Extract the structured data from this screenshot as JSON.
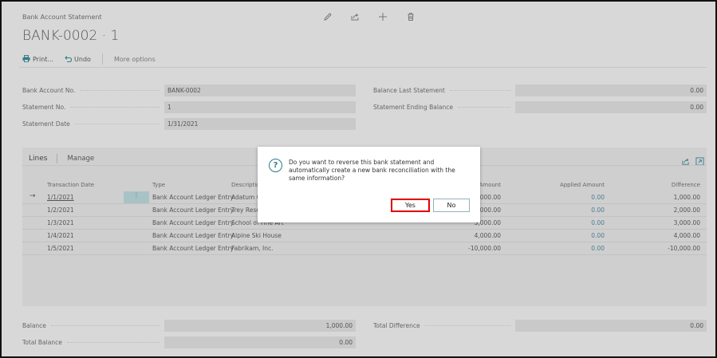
{
  "header": {
    "label": "Bank Account Statement",
    "title": "BANK-0002 · 1",
    "icons": [
      "edit-icon",
      "share-icon",
      "add-icon",
      "delete-icon"
    ]
  },
  "actions": {
    "print": "Print...",
    "undo": "Undo",
    "more": "More options"
  },
  "fields": {
    "bank_account_no": {
      "label": "Bank Account No.",
      "value": "BANK-0002"
    },
    "statement_no": {
      "label": "Statement No.",
      "value": "1"
    },
    "statement_date": {
      "label": "Statement Date",
      "value": "1/31/2021"
    },
    "balance_last_statement": {
      "label": "Balance Last Statement",
      "value": "0.00"
    },
    "statement_ending_balance": {
      "label": "Statement Ending Balance",
      "value": "0.00"
    }
  },
  "lines": {
    "tab_lines": "Lines",
    "tab_manage": "Manage",
    "columns": {
      "transaction_date": "Transaction Date",
      "type": "Type",
      "description": "Description",
      "amount": "Amount",
      "applied_amount": "Applied Amount",
      "difference": "Difference"
    },
    "rows": [
      {
        "date": "1/1/2021",
        "type": "Bank Account Ledger Entry",
        "description": "Adatum C",
        "amount": "1,000.00",
        "applied": "0.00",
        "difference": "1,000.00"
      },
      {
        "date": "1/2/2021",
        "type": "Bank Account Ledger Entry",
        "description": "Trey Rese",
        "amount": "2,000.00",
        "applied": "0.00",
        "difference": "2,000.00"
      },
      {
        "date": "1/3/2021",
        "type": "Bank Account Ledger Entry",
        "description": "School of Fine Art",
        "amount": "3,000.00",
        "applied": "0.00",
        "difference": "3,000.00"
      },
      {
        "date": "1/4/2021",
        "type": "Bank Account Ledger Entry",
        "description": "Alpine Ski House",
        "amount": "4,000.00",
        "applied": "0.00",
        "difference": "4,000.00"
      },
      {
        "date": "1/5/2021",
        "type": "Bank Account Ledger Entry",
        "description": "Fabrikam, Inc.",
        "amount": "-10,000.00",
        "applied": "0.00",
        "difference": "-10,000.00"
      }
    ]
  },
  "footer": {
    "balance": {
      "label": "Balance",
      "value": "1,000.00"
    },
    "total_balance": {
      "label": "Total Balance",
      "value": "0.00"
    },
    "total_difference": {
      "label": "Total Difference",
      "value": "0.00"
    }
  },
  "dialog": {
    "message": "Do you want to reverse this bank statement and automatically create a new bank reconciliation with the same information?",
    "yes": "Yes",
    "no": "No"
  },
  "colors": {
    "accent": "#2b7a8a",
    "highlight": "#e00000"
  }
}
